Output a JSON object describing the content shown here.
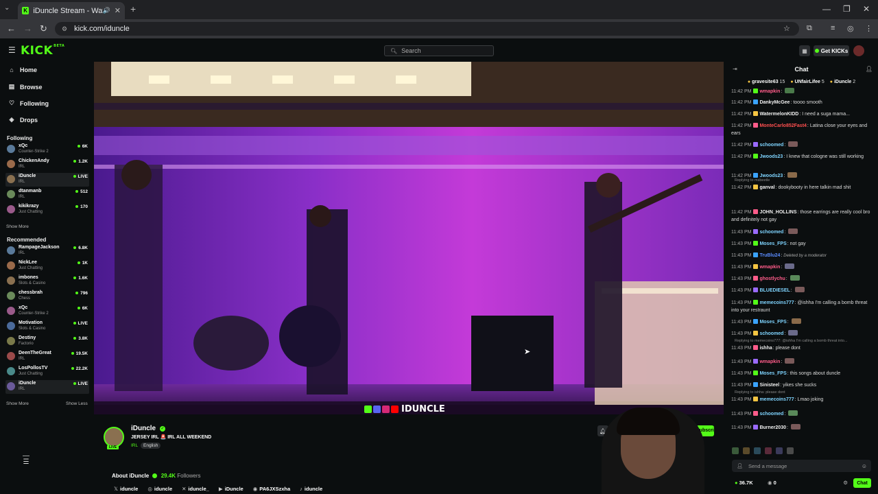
{
  "browser": {
    "tab_title": "iDuncle Stream - Watch Live",
    "url": "kick.com/iduncle"
  },
  "header": {
    "logo": "KICK",
    "logo_badge": "BETA",
    "search_placeholder": "Search",
    "get_kicks": "Get KICKs"
  },
  "sidebar": {
    "nav": [
      {
        "label": "Home",
        "icon": "home-icon"
      },
      {
        "label": "Browse",
        "icon": "browse-icon"
      },
      {
        "label": "Following",
        "icon": "heart-icon"
      },
      {
        "label": "Drops",
        "icon": "drops-icon"
      }
    ],
    "following_title": "Following",
    "following": [
      {
        "name": "xQc",
        "category": "Counter-Strike 2",
        "viewers": "6K"
      },
      {
        "name": "ChickenAndy",
        "category": "IRL",
        "viewers": "1.2K"
      },
      {
        "name": "iDuncle",
        "category": "IRL",
        "viewers": "LIVE"
      },
      {
        "name": "dtanmanb",
        "category": "IRL",
        "viewers": "512"
      },
      {
        "name": "kikikrazy",
        "category": "Just Chatting",
        "viewers": "170"
      }
    ],
    "show_more": "Show More",
    "recommended_title": "Recommended",
    "recommended": [
      {
        "name": "RampageJackson",
        "category": "IRL",
        "viewers": "6.8K"
      },
      {
        "name": "NickLee",
        "category": "Just Chatting",
        "viewers": "1K"
      },
      {
        "name": "imbones",
        "category": "Slots & Casino",
        "viewers": "1.6K"
      },
      {
        "name": "chessbrah",
        "category": "Chess",
        "viewers": "796"
      },
      {
        "name": "xQc",
        "category": "Counter-Strike 2",
        "viewers": "6K"
      },
      {
        "name": "Motivation",
        "category": "Slots & Casino",
        "viewers": "LIVE"
      },
      {
        "name": "Destiny",
        "category": "Factorio",
        "viewers": "3.8K"
      },
      {
        "name": "DeenTheGreat",
        "category": "IRL",
        "viewers": "19.5K"
      },
      {
        "name": "LosPollosTV",
        "category": "Just Chatting",
        "viewers": "22.2K"
      },
      {
        "name": "iDuncle",
        "category": "IRL",
        "viewers": "LIVE"
      }
    ],
    "show_more_2": "Show More",
    "show_less": "Show Less"
  },
  "stream": {
    "overlay_name": "IDUNCLE",
    "streamer": "iDuncle",
    "title": "JERSEY IRL 🚨 IRL ALL WEEKEND",
    "tags": [
      "IRL",
      "English"
    ],
    "live_badge": "LIVE",
    "about_label": "About iDuncle",
    "followers": "29.4K",
    "followers_label": "Followers",
    "subscribe_label": "Subscribe",
    "socials": [
      {
        "icon": "x-icon",
        "label": "iduncle"
      },
      {
        "icon": "instagram-icon",
        "label": "iduncle"
      },
      {
        "icon": "twitter-icon",
        "label": "iduncle_"
      },
      {
        "icon": "youtube-icon",
        "label": "iDuncle"
      },
      {
        "icon": "discord-icon",
        "label": "PA6JXSzxha"
      },
      {
        "icon": "tiktok-icon",
        "label": "iduncle"
      }
    ]
  },
  "chat": {
    "title": "Chat",
    "pinned": [
      {
        "name": "gravesite63",
        "count": "15"
      },
      {
        "name": "UNfairLifee",
        "count": "5"
      },
      {
        "name": "iDuncle",
        "count": "2"
      }
    ],
    "messages": [
      {
        "time": "11:42 PM",
        "user": "wmapkin",
        "color": "#ff5c8a",
        "text": ""
      },
      {
        "time": "11:42 PM",
        "user": "DankyMcGee",
        "color": "#f0f0f0",
        "text": "toooo smooth"
      },
      {
        "time": "11:42 PM",
        "user": "WatermelonKIDD",
        "color": "#f0f0f0",
        "text": "I need a suga mama..."
      },
      {
        "time": "11:42 PM",
        "user": "MonteCarlo852Fast4",
        "color": "#ff4f4f",
        "text": "Latina close your eyes and ears"
      },
      {
        "time": "11:42 PM",
        "user": "schoomed",
        "color": "#7fd4ff",
        "text": ""
      },
      {
        "time": "11:42 PM",
        "user": "Jwoods23",
        "color": "#7fd4ff",
        "text": "I knew that cologne was still working"
      },
      {
        "time": "11:42 PM",
        "user": "Jwoods23",
        "color": "#7fd4ff",
        "text": ""
      },
      {
        "time": "11:42 PM",
        "user": "ganval",
        "color": "#f0f0f0",
        "text": "dookybooty in here talkin mad shit",
        "reply": "Replying to msbeetle"
      },
      {
        "time": "11:42 PM",
        "user": "JOHN_HOLLINS",
        "color": "#f0f0f0",
        "text": "those earrings are really cool bro and definitely not gay"
      },
      {
        "time": "11:43 PM",
        "user": "schoomed",
        "color": "#7fd4ff",
        "text": ""
      },
      {
        "time": "11:43 PM",
        "user": "Moses_FPS",
        "color": "#7fd4ff",
        "text": "not gay"
      },
      {
        "time": "11:43 PM",
        "user": "TruBlu24",
        "color": "#5b8cff",
        "text": "Deleted by a moderator"
      },
      {
        "time": "11:43 PM",
        "user": "wmapkin",
        "color": "#ff5c8a",
        "text": ""
      },
      {
        "time": "11:43 PM",
        "user": "ghostlychu",
        "color": "#ff5c8a",
        "text": ""
      },
      {
        "time": "11:43 PM",
        "user": "BLUEDIESEL",
        "color": "#7fd4ff",
        "text": ""
      },
      {
        "time": "11:43 PM",
        "user": "memecoins777",
        "color": "#7fd4ff",
        "text": "@ishha I'm calling a bomb threat into your restraunt"
      },
      {
        "time": "11:43 PM",
        "user": "Moses_FPS",
        "color": "#7fd4ff",
        "text": ""
      },
      {
        "time": "11:43 PM",
        "user": "schoomed",
        "color": "#7fd4ff",
        "text": ""
      },
      {
        "time": "11:43 PM",
        "user": "ishha",
        "color": "#f0f0f0",
        "text": "please dont",
        "reply": "Replying to memecoins777: @ishha I'm calling a bomb threat into..."
      },
      {
        "time": "11:43 PM",
        "user": "wmapkin",
        "color": "#ff5c8a",
        "text": ""
      },
      {
        "time": "11:43 PM",
        "user": "Moses_FPS",
        "color": "#7fd4ff",
        "text": "this songs about duncle"
      },
      {
        "time": "11:43 PM",
        "user": "Sinisteel",
        "color": "#f0f0f0",
        "text": "yikes she sucks"
      },
      {
        "time": "11:43 PM",
        "user": "memecoins777",
        "color": "#7fd4ff",
        "text": "Lmao joking",
        "reply": "Replying to ishha: please dont"
      },
      {
        "time": "11:43 PM",
        "user": "schoomed",
        "color": "#7fd4ff",
        "text": ""
      },
      {
        "time": "11:43 PM",
        "user": "Burner2030",
        "color": "#f0f0f0",
        "text": ""
      }
    ],
    "input_placeholder": "Send a message",
    "viewers": "36.7K",
    "points": "0",
    "chat_button": "Chat"
  },
  "colors": {
    "accent": "#53fc18",
    "background": "#0b0e0f"
  }
}
